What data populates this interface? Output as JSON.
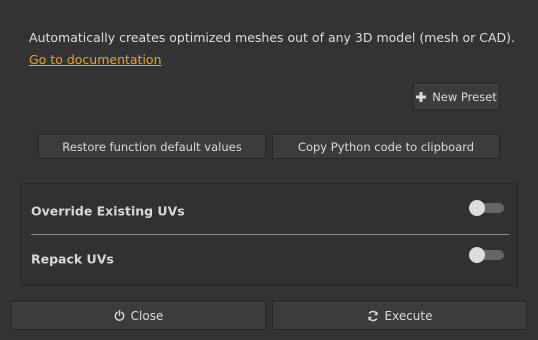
{
  "description": "Automatically creates optimized meshes out of any 3D model (mesh or CAD).",
  "doc_link": "Go to documentation",
  "buttons": {
    "new_preset": "New Preset",
    "restore_defaults": "Restore function default values",
    "copy_python": "Copy Python code to clipboard",
    "close": "Close",
    "execute": "Execute"
  },
  "options": [
    {
      "label": "Override Existing UVs",
      "enabled": false
    },
    {
      "label": "Repack UVs",
      "enabled": false
    }
  ],
  "icons": {
    "new_preset": "plus-icon",
    "close": "power-icon",
    "execute": "refresh-icon"
  },
  "colors": {
    "link": "#f0a21a",
    "background": "#333333"
  }
}
